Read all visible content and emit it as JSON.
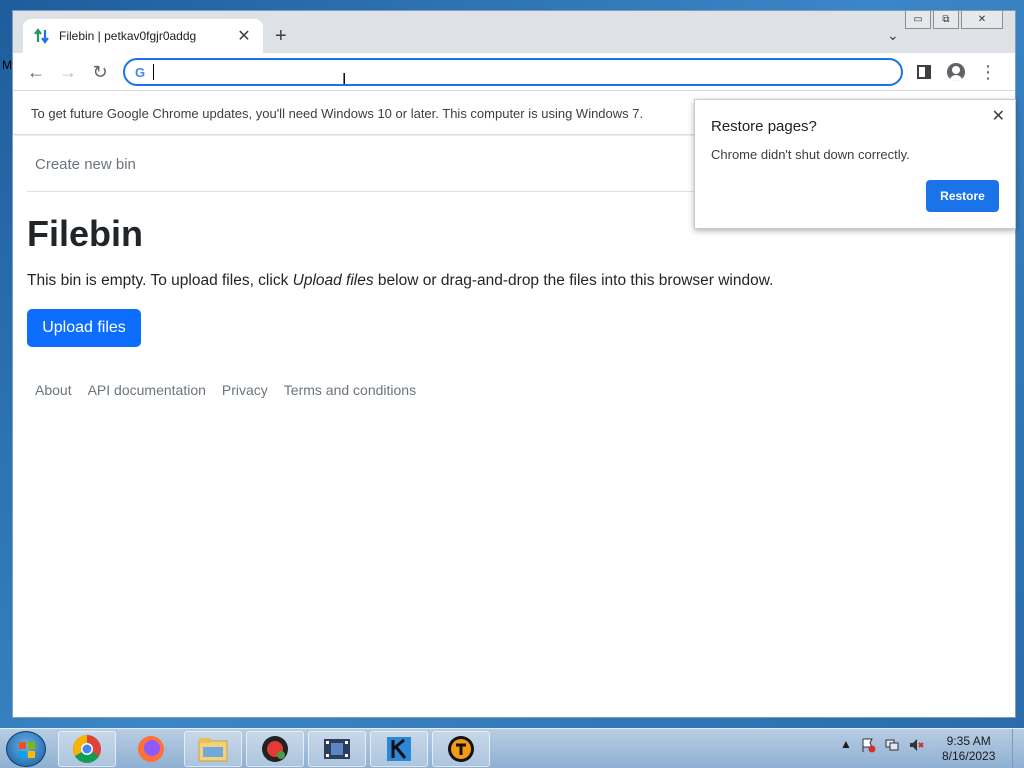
{
  "browser": {
    "tab": {
      "title": "Filebin | petkav0fgjr0addg",
      "close": "✕"
    },
    "new_tab_symbol": "+",
    "tab_search_symbol": "⌄",
    "window_controls": {
      "minimize": "▭",
      "maximize": "⧉",
      "close": "✕"
    },
    "toolbar": {
      "back": "←",
      "forward": "→",
      "reload": "↻",
      "menu": "⋮"
    },
    "omnibox": {
      "value": "",
      "google_icon": "G"
    },
    "infobar": {
      "text": "To get future Google Chrome updates, you'll need Windows 10 or later. This computer is using Windows 7."
    }
  },
  "page": {
    "nav_link": "Create new bin",
    "title": "Filebin",
    "lead": {
      "before": "This bin is empty. To upload files, click ",
      "emphasis": "Upload files",
      "after": " below or drag-and-drop the files into this browser window."
    },
    "upload_button": "Upload files",
    "footer": [
      "About",
      "API documentation",
      "Privacy",
      "Terms and conditions"
    ]
  },
  "restore_popup": {
    "title": "Restore pages?",
    "message": "Chrome didn't shut down correctly.",
    "close": "✕",
    "button": "Restore"
  },
  "desktop": {
    "edge_glyph": "M"
  },
  "taskbar": {
    "items": [
      "chrome-icon",
      "firefox-icon",
      "file-explorer-icon",
      "screen-recorder-icon",
      "video-editor-icon",
      "kdenlive-icon",
      "typora-icon"
    ],
    "tray": {
      "expand": "▲"
    },
    "clock": {
      "time": "9:35 AM",
      "date": "8/16/2023"
    }
  },
  "colors": {
    "accent": "#1a73e8",
    "bootstrap_primary": "#0d6efd",
    "text_muted": "#6c757d"
  }
}
